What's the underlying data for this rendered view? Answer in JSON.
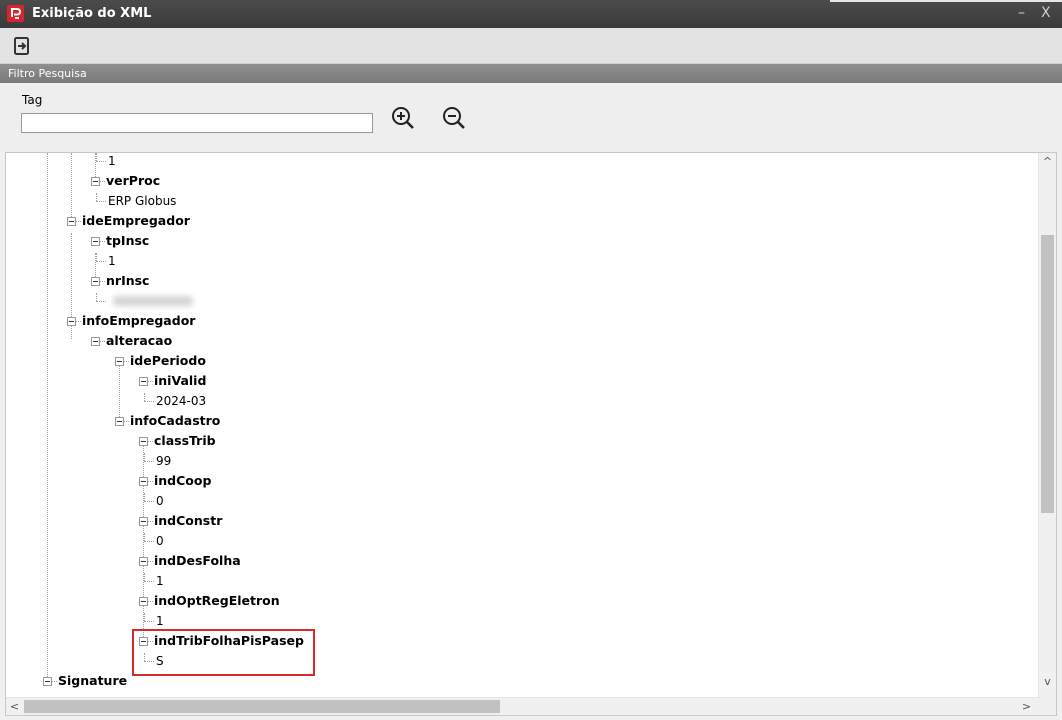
{
  "window": {
    "title": "Exibição do XML",
    "minimize_glyph": "–",
    "close_glyph": "X"
  },
  "toolbar": {
    "exit_icon": "exit-icon"
  },
  "filter": {
    "section_title": "Filtro Pesquisa",
    "tag_label": "Tag",
    "tag_value": "",
    "zoom_in_icon": "zoom-in-icon",
    "zoom_out_icon": "zoom-out-icon"
  },
  "tree": {
    "nodes": [
      {
        "text": "1",
        "kind": "value",
        "level": 3
      },
      {
        "text": "verProc",
        "kind": "tag",
        "level": 2
      },
      {
        "text": "ERP Globus",
        "kind": "value",
        "level": 3
      },
      {
        "text": "ideEmpregador",
        "kind": "tag",
        "level": 1
      },
      {
        "text": "tpInsc",
        "kind": "tag",
        "level": 2
      },
      {
        "text": "1",
        "kind": "value",
        "level": 3
      },
      {
        "text": "nrInsc",
        "kind": "tag",
        "level": 2
      },
      {
        "text": "",
        "kind": "value",
        "level": 3,
        "redacted": true
      },
      {
        "text": "infoEmpregador",
        "kind": "tag",
        "level": 1
      },
      {
        "text": "alteracao",
        "kind": "tag",
        "level": 2
      },
      {
        "text": "idePeriodo",
        "kind": "tag",
        "level": 3
      },
      {
        "text": "iniValid",
        "kind": "tag",
        "level": 4
      },
      {
        "text": "2024-03",
        "kind": "value",
        "level": 5
      },
      {
        "text": "infoCadastro",
        "kind": "tag",
        "level": 3
      },
      {
        "text": "classTrib",
        "kind": "tag",
        "level": 4
      },
      {
        "text": "99",
        "kind": "value",
        "level": 5
      },
      {
        "text": "indCoop",
        "kind": "tag",
        "level": 4
      },
      {
        "text": "0",
        "kind": "value",
        "level": 5
      },
      {
        "text": "indConstr",
        "kind": "tag",
        "level": 4
      },
      {
        "text": "0",
        "kind": "value",
        "level": 5
      },
      {
        "text": "indDesFolha",
        "kind": "tag",
        "level": 4
      },
      {
        "text": "1",
        "kind": "value",
        "level": 5
      },
      {
        "text": "indOptRegEletron",
        "kind": "tag",
        "level": 4
      },
      {
        "text": "1",
        "kind": "value",
        "level": 5
      },
      {
        "text": "indTribFolhaPisPasep",
        "kind": "tag",
        "level": 4,
        "highlighted": true
      },
      {
        "text": "S",
        "kind": "value",
        "level": 5,
        "highlighted": true
      },
      {
        "text": "Signature",
        "kind": "tag",
        "level": 0
      }
    ]
  },
  "colors": {
    "titlebar": "#3f3f3f",
    "section_bar": "#848484",
    "highlight_border": "#d42b2b",
    "logo": "#d8252b"
  }
}
